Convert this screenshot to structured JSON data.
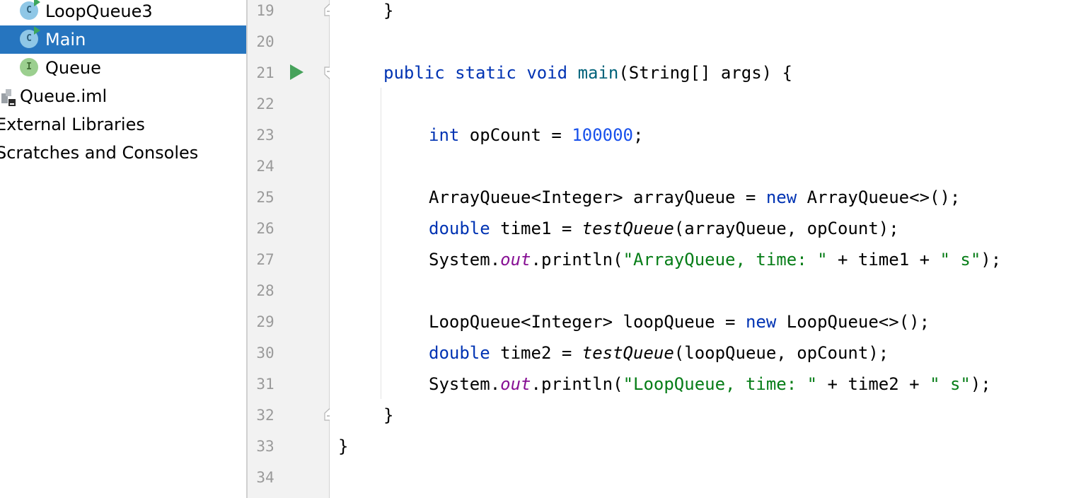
{
  "tree": {
    "items": [
      {
        "label": "LoopQueue3",
        "icon": "class-icon",
        "icon_letter": "C"
      },
      {
        "label": "Main",
        "icon": "class-icon",
        "icon_letter": "C",
        "selected": true
      },
      {
        "label": "Queue",
        "icon": "interface-icon",
        "icon_letter": "I"
      },
      {
        "label": "Queue.iml",
        "icon": "module-file-icon"
      },
      {
        "label": "External Libraries",
        "icon": null
      },
      {
        "label": "Scratches and Consoles",
        "icon": null
      }
    ]
  },
  "gutter": {
    "line_numbers": [
      "19",
      "20",
      "21",
      "22",
      "23",
      "24",
      "25",
      "26",
      "27",
      "28",
      "29",
      "30",
      "31",
      "32",
      "33",
      "34"
    ]
  },
  "editor": {
    "lines": {
      "l19": {
        "brace": "}"
      },
      "l21": {
        "kw1": "public",
        "kw2": "static",
        "kw3": "void",
        "fn": "main",
        "rest": "(String[] args) {"
      },
      "l23": {
        "kw": "int",
        "mid": " opCount = ",
        "num": "100000",
        "end": ";"
      },
      "l25": {
        "pre": "ArrayQueue<Integer> arrayQueue = ",
        "kw": "new",
        "post": " ArrayQueue<>();"
      },
      "l26": {
        "kw": "double",
        "mid": " time1 = ",
        "call": "testQueue",
        "post": "(arrayQueue, opCount);"
      },
      "l27": {
        "pre": "System.",
        "field": "out",
        "mid": ".println(",
        "s1": "\"ArrayQueue, time: \"",
        "mid2": " + time1 + ",
        "s2": "\" s\"",
        "end": ");"
      },
      "l29": {
        "pre": "LoopQueue<Integer> loopQueue = ",
        "kw": "new",
        "post": " LoopQueue<>();"
      },
      "l30": {
        "kw": "double",
        "mid": " time2 = ",
        "call": "testQueue",
        "post": "(loopQueue, opCount);"
      },
      "l31": {
        "pre": "System.",
        "field": "out",
        "mid": ".println(",
        "s1": "\"LoopQueue, time: \"",
        "mid2": " + time2 + ",
        "s2": "\" s\"",
        "end": ");"
      },
      "l32": {
        "brace": "}"
      },
      "l33": {
        "brace": "}"
      }
    }
  },
  "colors": {
    "selection": "#2675BF",
    "keyword": "#0033B3",
    "method": "#00627A",
    "number": "#1750EB",
    "string": "#067D17",
    "static_field": "#871094",
    "run_icon": "#46A25B"
  }
}
